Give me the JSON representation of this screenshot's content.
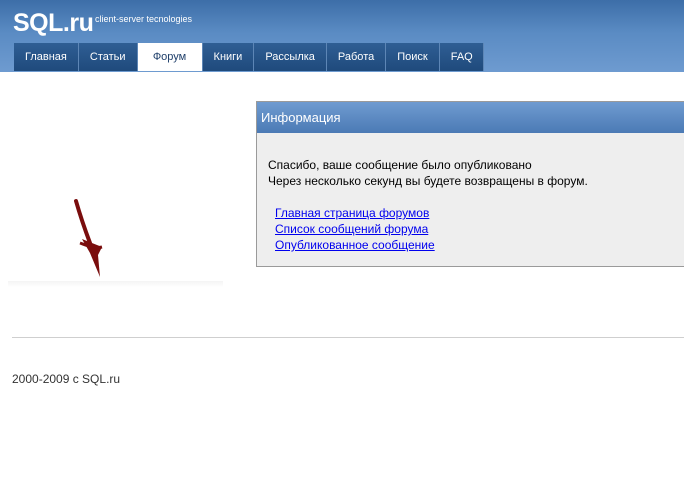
{
  "header": {
    "logo": "SQL.ru",
    "tagline": "client-server tecnologies"
  },
  "nav": {
    "tabs": [
      {
        "label": "Главная",
        "active": false
      },
      {
        "label": "Статьи",
        "active": false
      },
      {
        "label": "Форум",
        "active": true
      },
      {
        "label": "Книги",
        "active": false
      },
      {
        "label": "Рассылка",
        "active": false
      },
      {
        "label": "Работа",
        "active": false
      },
      {
        "label": "Поиск",
        "active": false
      },
      {
        "label": "FAQ",
        "active": false
      }
    ]
  },
  "annotation": {
    "icon": "arrow-down-icon",
    "color": "#7a0d0d"
  },
  "info": {
    "title": "Информация",
    "message_line1": "Спасибо, ваше сообщение было опубликовано",
    "message_line2": "Через несколько секунд вы будете возвращены в форум.",
    "links": [
      "Главная страница форумов",
      "Список сообщений форума",
      "Опубликованное сообщение"
    ]
  },
  "footer": {
    "copyright": "2000-2009 с SQL.ru"
  }
}
